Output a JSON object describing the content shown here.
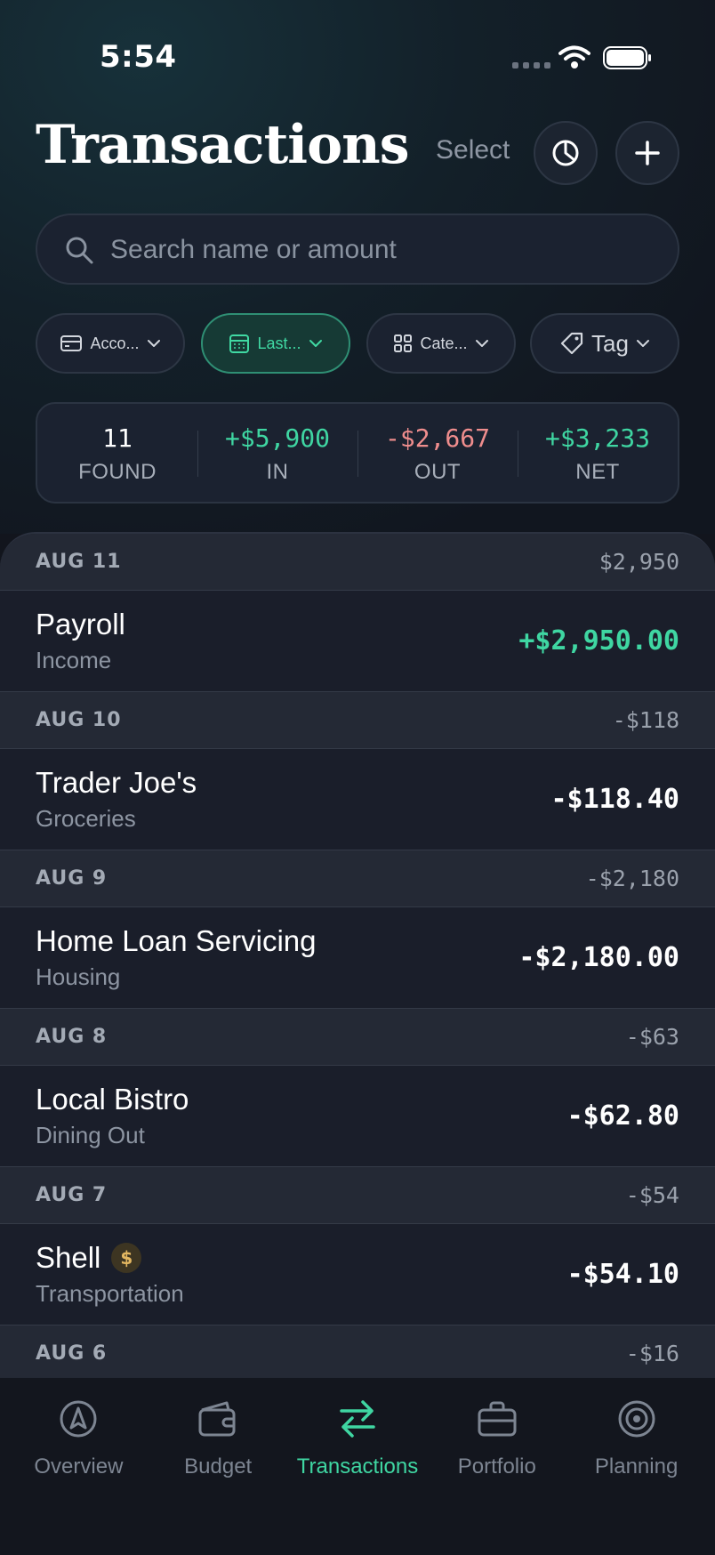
{
  "status_bar": {
    "time": "5:54"
  },
  "header": {
    "title": "Transactions",
    "select_label": "Select",
    "chart_button_icon": "pie-chart-icon",
    "add_button_icon": "plus-icon"
  },
  "search": {
    "placeholder": "Search name or amount",
    "value": ""
  },
  "filters": [
    {
      "label": "Acco...",
      "icon": "card-icon",
      "active": false
    },
    {
      "label": "Last...",
      "icon": "calendar-icon",
      "active": true
    },
    {
      "label": "Cate...",
      "icon": "grid-icon",
      "active": false
    },
    {
      "label": "Tag",
      "icon": "tag-icon",
      "active": false
    }
  ],
  "summary": {
    "found": {
      "value": "11",
      "label": "FOUND"
    },
    "in": {
      "value": "+$5,900",
      "label": "IN"
    },
    "out": {
      "value": "-$2,667",
      "label": "OUT"
    },
    "net": {
      "value": "+$3,233",
      "label": "NET"
    }
  },
  "groups": [
    {
      "date": "AUG 11",
      "total": "$2,950",
      "tx": {
        "name": "Payroll",
        "category": "Income",
        "amount": "+$2,950.00",
        "positive": true
      }
    },
    {
      "date": "AUG 10",
      "total": "-$118",
      "tx": {
        "name": "Trader Joe's",
        "category": "Groceries",
        "amount": "-$118.40"
      }
    },
    {
      "date": "AUG 9",
      "total": "-$2,180",
      "tx": {
        "name": "Home Loan Servicing",
        "category": "Housing",
        "amount": "-$2,180.00"
      }
    },
    {
      "date": "AUG 8",
      "total": "-$63",
      "tx": {
        "name": "Local Bistro",
        "category": "Dining Out",
        "amount": "-$62.80"
      }
    },
    {
      "date": "AUG 7",
      "total": "-$54",
      "tx": {
        "name": "Shell",
        "category": "Transportation",
        "amount": "-$54.10",
        "badge": "$"
      }
    },
    {
      "date": "AUG 6",
      "total": "-$16"
    }
  ],
  "tabs": [
    {
      "label": "Overview",
      "icon": "compass-icon"
    },
    {
      "label": "Budget",
      "icon": "wallet-icon"
    },
    {
      "label": "Transactions",
      "icon": "transfer-icon",
      "active": true
    },
    {
      "label": "Portfolio",
      "icon": "briefcase-icon"
    },
    {
      "label": "Planning",
      "icon": "target-icon"
    }
  ],
  "colors": {
    "accent": "#3fd6a2",
    "negative": "#ef8d8d",
    "background": "#12151d"
  }
}
